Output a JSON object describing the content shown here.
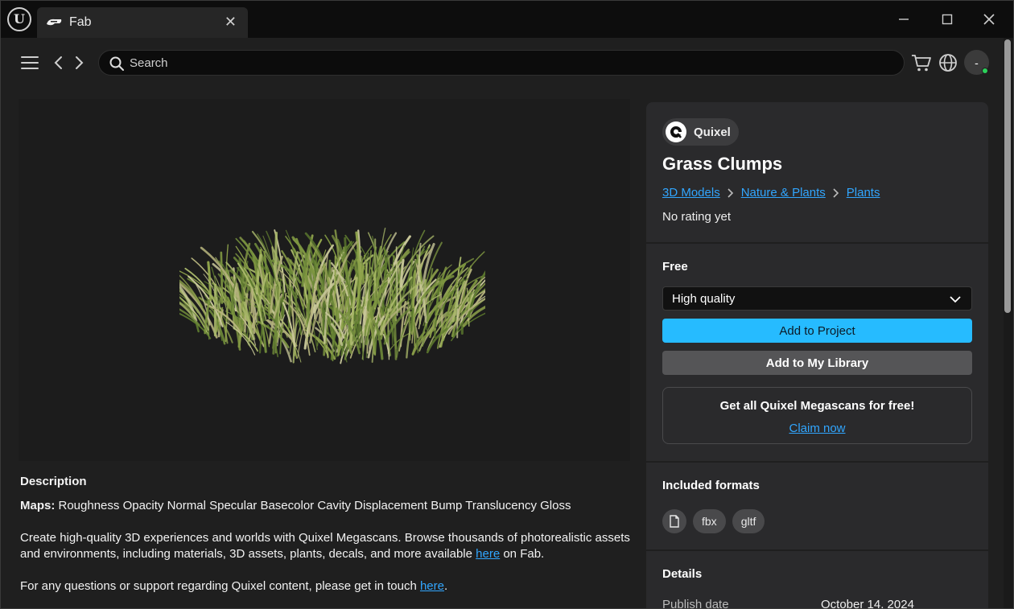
{
  "titlebar": {
    "tab_title": "Fab",
    "icons": [
      "unreal-logo-icon",
      "fab-logo-icon",
      "close-icon",
      "minimize-icon",
      "maximize-icon",
      "window-close-icon"
    ]
  },
  "navbar": {
    "search_placeholder": "Search",
    "avatar_label": "-"
  },
  "product": {
    "seller": "Quixel",
    "title": "Grass Clumps",
    "breadcrumbs": [
      "3D Models",
      "Nature & Plants",
      "Plants"
    ],
    "rating": "No rating yet",
    "price": "Free",
    "quality_selected": "High quality",
    "add_to_project": "Add to Project",
    "add_to_library": "Add to My Library"
  },
  "promo": {
    "title": "Get all Quixel Megascans for free!",
    "link": "Claim now"
  },
  "formats": {
    "title": "Included formats",
    "items": [
      "fbx",
      "gltf"
    ]
  },
  "details": {
    "title": "Details",
    "rows": [
      {
        "label": "Publish date",
        "value": "October 14, 2024"
      }
    ]
  },
  "description": {
    "title": "Description",
    "maps_label": "Maps:",
    "maps_value": " Roughness Opacity Normal Specular Basecolor Cavity Displacement Bump Translucency Gloss",
    "para1_before": "Create high-quality 3D experiences and worlds with Quixel Megascans. Browse thousands of photorealistic assets and environments, including materials, 3D assets, plants, decals, and more available ",
    "para1_link": "here",
    "para1_after": " on Fab.",
    "para2_before": "For any questions or support regarding Quixel content, please get in touch ",
    "para2_link": "here",
    "para2_after": "."
  },
  "colors": {
    "accent": "#26bbff",
    "link": "#31a6ff",
    "panel": "#2a2a2c",
    "online": "#2bd15a"
  }
}
